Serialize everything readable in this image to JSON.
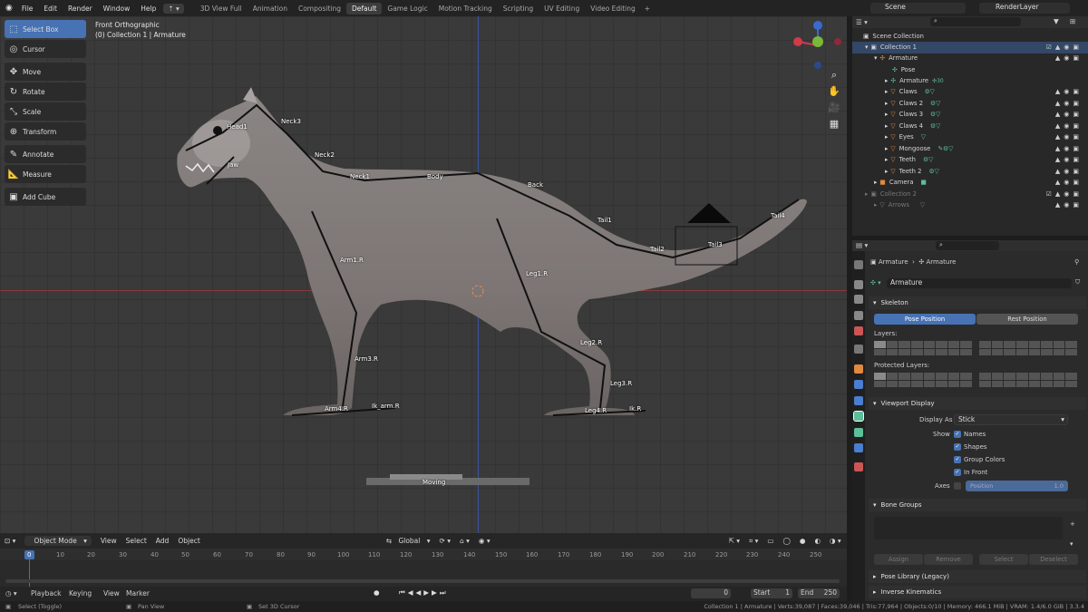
{
  "menu": {
    "items": [
      "File",
      "Edit",
      "Render",
      "Window",
      "Help"
    ],
    "workspaces": [
      "3D View Full",
      "Animation",
      "Compositing",
      "Default",
      "Game Logic",
      "Motion Tracking",
      "Scripting",
      "UV Editing",
      "Video Editing"
    ],
    "scene_label": "Scene",
    "view_layer_label": "RenderLayer"
  },
  "toolbar": {
    "tools": [
      "Select Box",
      "Cursor",
      "Move",
      "Rotate",
      "Scale",
      "Transform",
      "Annotate",
      "Measure",
      "Add Cube"
    ]
  },
  "viewport": {
    "view_name": "Front Orthographic",
    "collection_path": "(0) Collection 1 | Armature",
    "bones": [
      "Head1",
      "Jaw",
      "Neck3",
      "Neck2",
      "Neck1",
      "Body",
      "Back",
      "Tail1",
      "Tail2",
      "Tail3",
      "Tail4",
      "Arm1.R",
      "Arm3.R",
      "Arm4.R",
      "Ik_arm.R",
      "Leg1.R",
      "Leg2.R",
      "Leg3.R",
      "Leg4.R",
      "Ik.R"
    ],
    "moving_label": "Moving"
  },
  "viewport_header": {
    "mode": "Object Mode",
    "menus": [
      "View",
      "Select",
      "Add",
      "Object"
    ],
    "transform_orientation": "Global"
  },
  "timeline": {
    "frames": [
      "0",
      "10",
      "20",
      "30",
      "40",
      "50",
      "60",
      "70",
      "80",
      "90",
      "100",
      "110",
      "120",
      "130",
      "140",
      "150",
      "160",
      "170",
      "180",
      "190",
      "200",
      "210",
      "220",
      "230",
      "240",
      "250"
    ],
    "menus": [
      "Playback",
      "Keying",
      "View",
      "Marker"
    ],
    "current_frame": "0",
    "start_label": "Start",
    "start": "1",
    "end_label": "End",
    "end": "250"
  },
  "status": {
    "select": "Select (Toggle)",
    "pan": "Pan View",
    "cursor": "Set 3D Cursor",
    "stats": "Collection 1 | Armature | Verts:39,087 | Faces:39,046 | Tris:77,964 | Objects:0/10 | Memory: 466.1 MiB | VRAM: 1.4/6.0 GiB | 3.3.4"
  },
  "outliner": {
    "root": "Scene Collection",
    "rows": [
      "Collection 1",
      "Armature",
      "Pose",
      "Armature",
      "Claws",
      "Claws 2",
      "Claws 3",
      "Claws 4",
      "Eyes",
      "Mongoose",
      "Teeth",
      "Teeth 2",
      "Camera",
      "Collection 2",
      "Arrows"
    ],
    "sub_badge": "30"
  },
  "properties": {
    "breadcrumb_object": "Armature",
    "breadcrumb_data": "Armature",
    "data_name": "Armature",
    "skeleton": {
      "title": "Skeleton",
      "pose_position": "Pose Position",
      "rest_position": "Rest Position",
      "layers": "Layers:",
      "protected_layers": "Protected Layers:"
    },
    "viewport_display": {
      "title": "Viewport Display",
      "display_as_label": "Display As",
      "display_as": "Stick",
      "show_label": "Show",
      "options": [
        "Names",
        "Shapes",
        "Group Colors",
        "In Front"
      ],
      "axes_label": "Axes",
      "axes_position": "Position",
      "axes_value": "1.0"
    },
    "bone_groups": {
      "title": "Bone Groups",
      "assign": "Assign",
      "remove": "Remove",
      "select": "Select",
      "deselect": "Deselect"
    },
    "more_panels": [
      "Pose Library (Legacy)",
      "Inverse Kinematics"
    ]
  },
  "colors": {
    "accent": "#4772b3",
    "viewport_bg": "#3a3a3a",
    "grid": "#333333",
    "x_axis": "#9a3a3a",
    "y_axis": "#3a55a0",
    "bone": "#111111"
  }
}
